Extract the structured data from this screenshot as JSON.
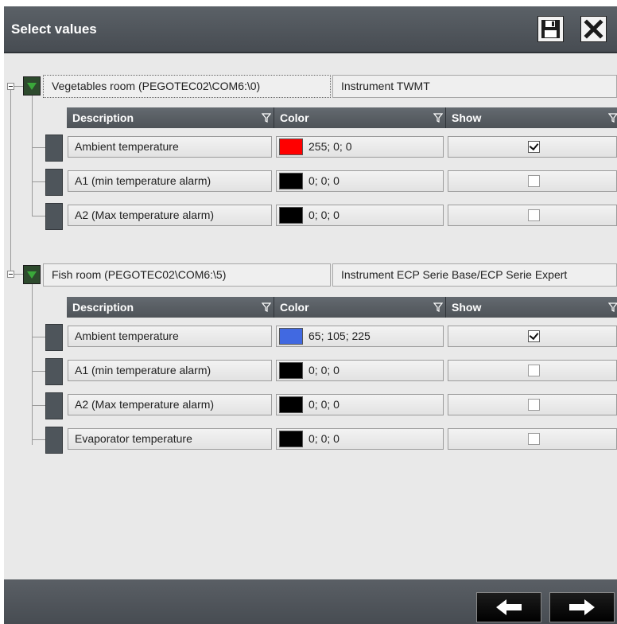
{
  "window": {
    "title": "Select values",
    "save_icon": "floppy-disk-icon",
    "close_icon": "close-icon"
  },
  "columns": {
    "description": "Description",
    "color": "Color",
    "show": "Show"
  },
  "groups": [
    {
      "room": "Vegetables room (PEGOTEC02\\COM6:\\0)",
      "instrument": "Instrument TWMT",
      "rows": [
        {
          "description": "Ambient temperature",
          "color_text": "255; 0; 0",
          "color_hex": "#ff0000",
          "show": true
        },
        {
          "description": "A1 (min temperature alarm)",
          "color_text": "0; 0; 0",
          "color_hex": "#000000",
          "show": false
        },
        {
          "description": "A2 (Max temperature alarm)",
          "color_text": "0; 0; 0",
          "color_hex": "#000000",
          "show": false
        }
      ]
    },
    {
      "room": "Fish room (PEGOTEC02\\COM6:\\5)",
      "instrument": "Instrument ECP Serie Base/ECP Serie Expert",
      "rows": [
        {
          "description": "Ambient temperature",
          "color_text": "65; 105; 225",
          "color_hex": "#4169e1",
          "show": true
        },
        {
          "description": "A1 (min temperature alarm)",
          "color_text": "0; 0; 0",
          "color_hex": "#000000",
          "show": false
        },
        {
          "description": "A2 (Max temperature alarm)",
          "color_text": "0; 0; 0",
          "color_hex": "#000000",
          "show": false
        },
        {
          "description": "Evaporator temperature",
          "color_text": "0; 0; 0",
          "color_hex": "#000000",
          "show": false
        }
      ]
    }
  ],
  "footer": {
    "back_icon": "arrow-left-icon",
    "next_icon": "arrow-right-icon"
  },
  "colors": {
    "titlebar": "#4f5459",
    "header": "#575c62",
    "group_icon": "#2d4a2d",
    "arrow": "#3aa83a"
  }
}
